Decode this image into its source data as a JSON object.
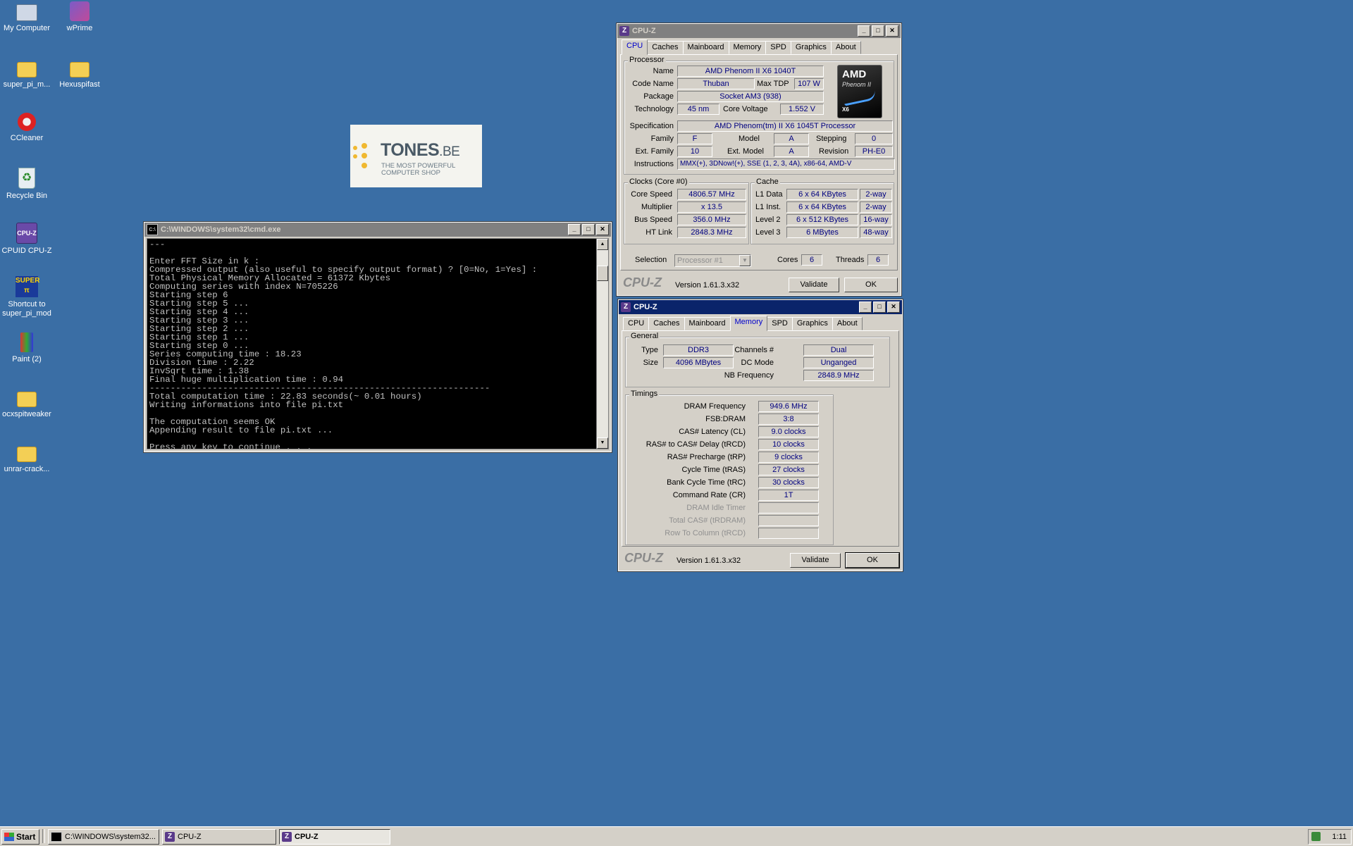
{
  "desktop": {
    "icons": [
      {
        "label": "My Computer",
        "icon": "computer-icon"
      },
      {
        "label": "wPrime",
        "icon": "wprime-icon"
      },
      {
        "label": "super_pi_m...",
        "icon": "folder-icon"
      },
      {
        "label": "Hexuspifast",
        "icon": "folder-icon"
      },
      {
        "label": "CCleaner",
        "icon": "ccleaner-icon"
      },
      {
        "label": "Recycle Bin",
        "icon": "recycle-bin-icon"
      },
      {
        "label": "CPUID CPU-Z",
        "icon": "cpuz-icon"
      },
      {
        "label": "Shortcut to super_pi_mod",
        "icon": "superpi-icon"
      },
      {
        "label": "Paint (2)",
        "icon": "paint-icon"
      },
      {
        "label": "ocxspitweaker",
        "icon": "folder-icon"
      },
      {
        "label": "unrar-crack...",
        "icon": "folder-icon"
      }
    ],
    "banner": {
      "brand": "TONES",
      "suffix": ".BE",
      "tagline1": "THE MOST POWERFUL",
      "tagline2": "COMPUTER SHOP"
    }
  },
  "cmd": {
    "title": "C:\\WINDOWS\\system32\\cmd.exe",
    "output": "---\n\nEnter FFT Size in k :\nCompressed output (also useful to specify output format) ? [0=No, 1=Yes] :\nTotal Physical Memory Allocated = 61372 Kbytes\nComputing series with index N=705226\nStarting step 6\nStarting step 5 ...\nStarting step 4 ...\nStarting step 3 ...\nStarting step 2 ...\nStarting step 1 ...\nStarting step 0 ...\nSeries computing time : 18.23\nDivision time : 2.22\nInvSqrt time : 1.38\nFinal huge multiplication time : 0.94\n-----------------------------------------------------------------\nTotal computation time : 22.83 seconds(~ 0.01 hours)\nWriting informations into file pi.txt\n\nThe computation seems OK\nAppending result to file pi.txt ...\n\nPress any key to continue . . ."
  },
  "cpuz_cpu": {
    "title": "CPU-Z",
    "tabs": [
      "CPU",
      "Caches",
      "Mainboard",
      "Memory",
      "SPD",
      "Graphics",
      "About"
    ],
    "processor_group": "Processor",
    "labels": {
      "name": "Name",
      "code_name": "Code Name",
      "max_tdp": "Max TDP",
      "package": "Package",
      "technology": "Technology",
      "core_voltage": "Core Voltage",
      "specification": "Specification",
      "family": "Family",
      "model": "Model",
      "stepping": "Stepping",
      "ext_family": "Ext. Family",
      "ext_model": "Ext. Model",
      "revision": "Revision",
      "instructions": "Instructions"
    },
    "values": {
      "name": "AMD Phenom II X6 1040T",
      "code_name": "Thuban",
      "max_tdp": "107 W",
      "package": "Socket AM3 (938)",
      "technology": "45 nm",
      "core_voltage": "1.552 V",
      "specification": "AMD Phenom(tm) II X6 1045T Processor",
      "family": "F",
      "model": "A",
      "stepping": "0",
      "ext_family": "10",
      "ext_model": "A",
      "revision": "PH-E0",
      "instructions": "MMX(+), 3DNow!(+), SSE (1, 2, 3, 4A), x86-64, AMD-V"
    },
    "logo": {
      "brand": "AMD",
      "line": "Phenom II",
      "badge": "X6"
    },
    "clocks_group": "Clocks (Core #0)",
    "clocks": [
      {
        "label": "Core Speed",
        "value": "4806.57 MHz"
      },
      {
        "label": "Multiplier",
        "value": "x 13.5"
      },
      {
        "label": "Bus Speed",
        "value": "356.0 MHz"
      },
      {
        "label": "HT Link",
        "value": "2848.3 MHz"
      }
    ],
    "cache_group": "Cache",
    "cache": [
      {
        "label": "L1 Data",
        "size": "6 x 64 KBytes",
        "way": "2-way"
      },
      {
        "label": "L1 Inst.",
        "size": "6 x 64 KBytes",
        "way": "2-way"
      },
      {
        "label": "Level 2",
        "size": "6 x 512 KBytes",
        "way": "16-way"
      },
      {
        "label": "Level 3",
        "size": "6 MBytes",
        "way": "48-way"
      }
    ],
    "selection_label": "Selection",
    "selection_value": "Processor #1",
    "cores_label": "Cores",
    "cores_value": "6",
    "threads_label": "Threads",
    "threads_value": "6",
    "brand": "CPU-Z",
    "version": "Version 1.61.3.x32",
    "validate": "Validate",
    "ok": "OK"
  },
  "cpuz_mem": {
    "title": "CPU-Z",
    "tabs": [
      "CPU",
      "Caches",
      "Mainboard",
      "Memory",
      "SPD",
      "Graphics",
      "About"
    ],
    "general_group": "General",
    "general": {
      "type_label": "Type",
      "type": "DDR3",
      "size_label": "Size",
      "size": "4096 MBytes",
      "channels_label": "Channels #",
      "channels": "Dual",
      "dcmode_label": "DC Mode",
      "dcmode": "Unganged",
      "nbfreq_label": "NB Frequency",
      "nbfreq": "2848.9 MHz"
    },
    "timings_group": "Timings",
    "timings": [
      {
        "label": "DRAM Frequency",
        "value": "949.6 MHz"
      },
      {
        "label": "FSB:DRAM",
        "value": "3:8"
      },
      {
        "label": "CAS# Latency (CL)",
        "value": "9.0 clocks"
      },
      {
        "label": "RAS# to CAS# Delay (tRCD)",
        "value": "10 clocks"
      },
      {
        "label": "RAS# Precharge (tRP)",
        "value": "9 clocks"
      },
      {
        "label": "Cycle Time (tRAS)",
        "value": "27 clocks"
      },
      {
        "label": "Bank Cycle Time (tRC)",
        "value": "30 clocks"
      },
      {
        "label": "Command Rate (CR)",
        "value": "1T"
      },
      {
        "label": "DRAM Idle Timer",
        "value": ""
      },
      {
        "label": "Total CAS# (tRDRAM)",
        "value": ""
      },
      {
        "label": "Row To Column (tRCD)",
        "value": ""
      }
    ],
    "brand": "CPU-Z",
    "version": "Version 1.61.3.x32",
    "validate": "Validate",
    "ok": "OK"
  },
  "taskbar": {
    "start": "Start",
    "items": [
      "C:\\WINDOWS\\system32...",
      "CPU-Z",
      "CPU-Z"
    ],
    "clock": "1:11"
  }
}
